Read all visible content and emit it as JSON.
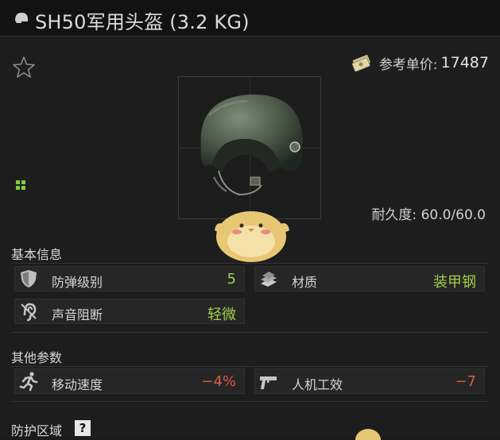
{
  "window": {
    "title": "SH50军用头盔 (3.2 KG)"
  },
  "price": {
    "label": "参考单价:",
    "value": "17487"
  },
  "item": {
    "durability": "耐久度: 60.0/60.0"
  },
  "sections": {
    "basic": "基本信息",
    "other": "其他参数",
    "protection": "防护区域"
  },
  "stats": {
    "armor_class": {
      "label": "防弹级别",
      "value": "5"
    },
    "material": {
      "label": "材质",
      "value": "装甲钢"
    },
    "sound_block": {
      "label": "声音阻断",
      "value": "轻微"
    },
    "move_speed": {
      "label": "移动速度",
      "value": "−4%"
    },
    "ergonomics": {
      "label": "人机工效",
      "value": "−7"
    }
  },
  "help": {
    "label": "?"
  },
  "colors": {
    "positive": "#9fce4b",
    "negative": "#dc5a48",
    "slot_green": "#7fcf3f"
  },
  "icons": [
    "helmet-icon",
    "star-icon",
    "money-icon",
    "shield-icon",
    "material-icon",
    "ear-icon",
    "running-icon",
    "pistol-icon"
  ]
}
